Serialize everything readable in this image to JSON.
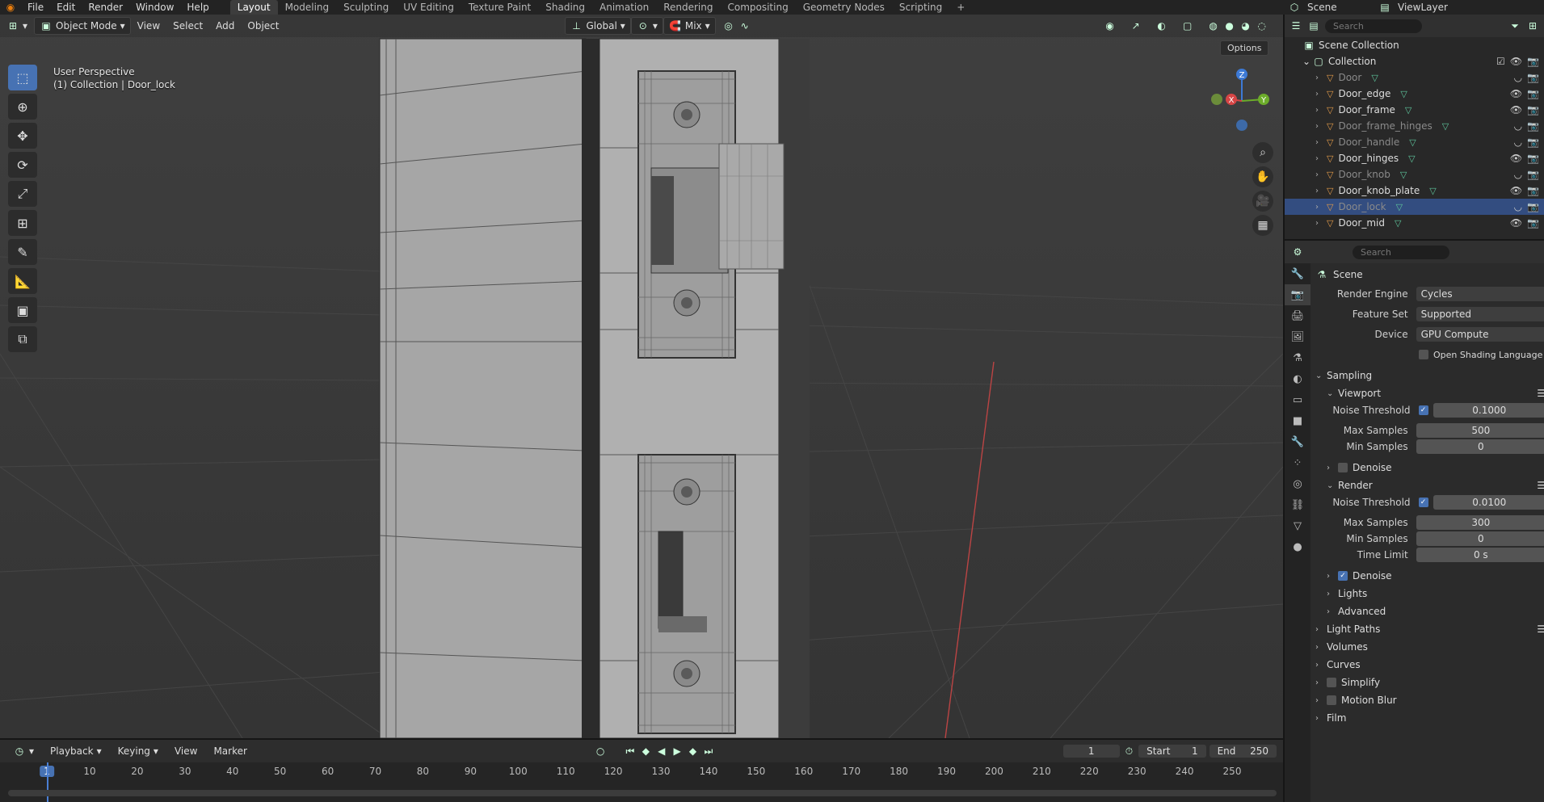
{
  "topbar": {
    "menus": [
      "File",
      "Edit",
      "Render",
      "Window",
      "Help"
    ],
    "workspaces": [
      "Layout",
      "Modeling",
      "Sculpting",
      "UV Editing",
      "Texture Paint",
      "Shading",
      "Animation",
      "Rendering",
      "Compositing",
      "Geometry Nodes",
      "Scripting"
    ],
    "active_workspace": "Layout",
    "scene_label": "Scene",
    "viewlayer_label": "ViewLayer"
  },
  "viewport": {
    "mode": "Object Mode",
    "menus": [
      "View",
      "Select",
      "Add",
      "Object"
    ],
    "orientation": "Global",
    "snap_mode": "Mix",
    "options_label": "Options",
    "overlay_line1": "User Perspective",
    "overlay_line2": "(1) Collection | Door_lock",
    "gizmo": {
      "x": "X",
      "y": "Y",
      "z": "Z"
    }
  },
  "outliner": {
    "search_placeholder": "Search",
    "scene_collection": "Scene Collection",
    "collection": "Collection",
    "items": [
      {
        "name": "Door",
        "visible": false
      },
      {
        "name": "Door_edge",
        "visible": true
      },
      {
        "name": "Door_frame",
        "visible": true
      },
      {
        "name": "Door_frame_hinges",
        "visible": false
      },
      {
        "name": "Door_handle",
        "visible": false
      },
      {
        "name": "Door_hinges",
        "visible": true
      },
      {
        "name": "Door_knob",
        "visible": false
      },
      {
        "name": "Door_knob_plate",
        "visible": true
      },
      {
        "name": "Door_lock",
        "visible": false,
        "selected": true
      },
      {
        "name": "Door_mid",
        "visible": true
      }
    ]
  },
  "properties": {
    "search_placeholder": "Search",
    "context": "Scene",
    "render_engine_label": "Render Engine",
    "render_engine": "Cycles",
    "feature_set_label": "Feature Set",
    "feature_set": "Supported",
    "device_label": "Device",
    "device": "GPU Compute",
    "osl_label": "Open Shading Language",
    "sampling": "Sampling",
    "viewport": "Viewport",
    "vp_noise_threshold_label": "Noise Threshold",
    "vp_noise_threshold": "0.1000",
    "vp_max_samples_label": "Max Samples",
    "vp_max_samples": "500",
    "vp_min_samples_label": "Min Samples",
    "vp_min_samples": "0",
    "vp_denoise": "Denoise",
    "render": "Render",
    "r_noise_threshold_label": "Noise Threshold",
    "r_noise_threshold": "0.0100",
    "r_max_samples_label": "Max Samples",
    "r_max_samples": "300",
    "r_min_samples_label": "Min Samples",
    "r_min_samples": "0",
    "r_time_limit_label": "Time Limit",
    "r_time_limit": "0 s",
    "r_denoise": "Denoise",
    "lights": "Lights",
    "advanced": "Advanced",
    "light_paths": "Light Paths",
    "volumes": "Volumes",
    "curves": "Curves",
    "simplify": "Simplify",
    "motion_blur": "Motion Blur",
    "film": "Film"
  },
  "timeline": {
    "menus": [
      "Playback",
      "Keying",
      "View",
      "Marker"
    ],
    "current_frame": "1",
    "start_label": "Start",
    "start": "1",
    "end_label": "End",
    "end": "250",
    "ruler": [
      "1",
      "10",
      "20",
      "30",
      "40",
      "50",
      "60",
      "70",
      "80",
      "90",
      "100",
      "110",
      "120",
      "130",
      "140",
      "150",
      "160",
      "170",
      "180",
      "190",
      "200",
      "210",
      "220",
      "230",
      "240",
      "250"
    ]
  }
}
